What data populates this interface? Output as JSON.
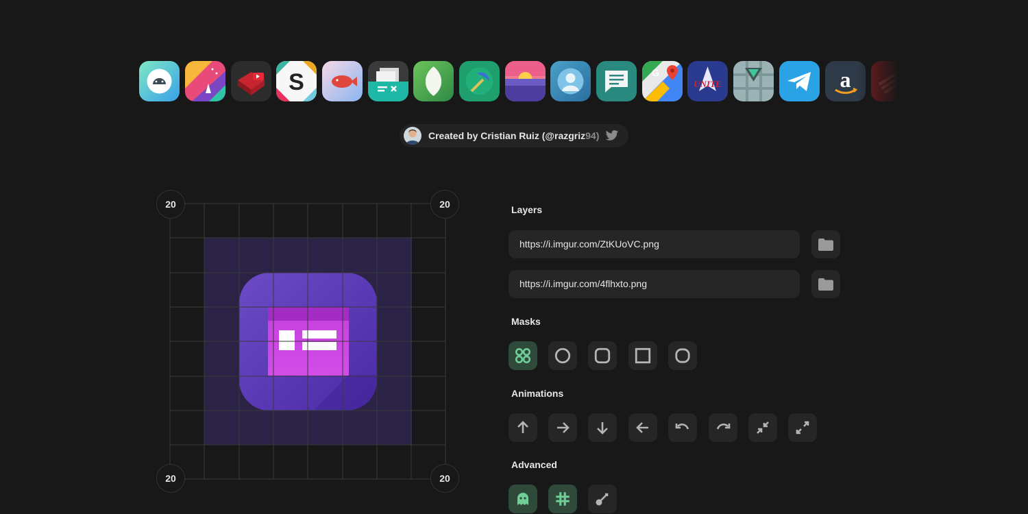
{
  "app_icons": [
    {
      "name": "android-app-icon"
    },
    {
      "name": "paint-app-icon"
    },
    {
      "name": "youtube-app-icon"
    },
    {
      "name": "slack-app-icon"
    },
    {
      "name": "fish-app-icon"
    },
    {
      "name": "cards-app-icon"
    },
    {
      "name": "leaf-app-icon"
    },
    {
      "name": "pickaxe-app-icon"
    },
    {
      "name": "sunset-app-icon"
    },
    {
      "name": "contact-app-icon"
    },
    {
      "name": "messages-app-icon"
    },
    {
      "name": "maps-app-icon"
    },
    {
      "name": "unite-app-icon"
    },
    {
      "name": "shirt-app-icon"
    },
    {
      "name": "telegram-app-icon"
    },
    {
      "name": "amazon-app-icon"
    },
    {
      "name": "bank-app-icon"
    }
  ],
  "credit": {
    "text_main": "Created by Cristian Ruiz (@razgriz",
    "text_dim": "94)",
    "social_icon": "twitter-icon"
  },
  "preview": {
    "padding_top_left": "20",
    "padding_top_right": "20",
    "padding_bottom_left": "20",
    "padding_bottom_right": "20",
    "icon": "forms-icon",
    "icon_gradient": [
      "#6d4bc7",
      "#4b2aa6"
    ],
    "zone_color": "#2a2346"
  },
  "layers": {
    "title": "Layers",
    "items": [
      {
        "value": "https://i.imgur.com/ZtKUoVC.png",
        "button_icon": "folder-icon"
      },
      {
        "value": "https://i.imgur.com/4flhxto.png",
        "button_icon": "folder-icon"
      }
    ]
  },
  "masks": {
    "title": "Masks",
    "options": [
      "dots-grid-icon",
      "circle-mask-icon",
      "rounded-square-mask-icon",
      "square-mask-icon",
      "squircle-mask-icon"
    ],
    "selected": "dots-grid-icon"
  },
  "animations": {
    "title": "Animations",
    "options": [
      "arrow-up-icon",
      "arrow-right-icon",
      "arrow-down-icon",
      "arrow-left-icon",
      "undo-icon",
      "redo-icon",
      "shrink-icon",
      "expand-icon"
    ]
  },
  "advanced": {
    "title": "Advanced",
    "options": [
      "ghost-icon",
      "hash-icon",
      "key-icon"
    ],
    "active": [
      "ghost-icon",
      "hash-icon"
    ]
  },
  "colors": {
    "accent": "#6fcf97",
    "active_bg": "#2f4a3b",
    "button_bg": "#262626",
    "background": "#181818"
  }
}
